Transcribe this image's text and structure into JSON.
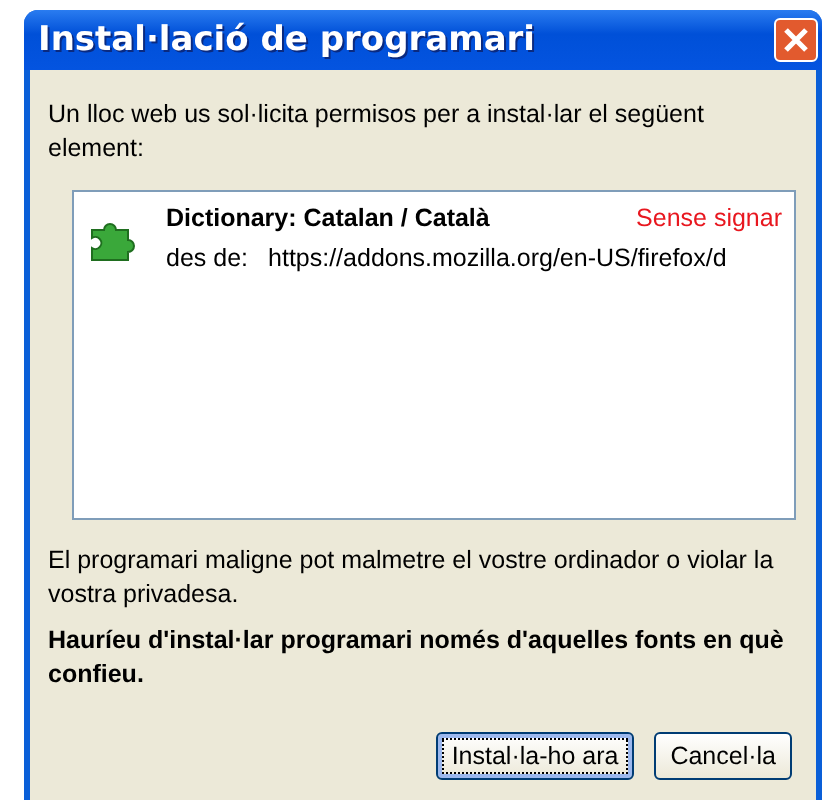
{
  "window": {
    "title": "Instal·lació de programari"
  },
  "intro": "Un lloc web us sol·licita permisos per a instal·lar el següent element:",
  "items": [
    {
      "name": "Dictionary: Catalan / Català",
      "status": "Sense signar",
      "from_label": "des de:",
      "url": "https://addons.mozilla.org/en-US/firefox/d"
    }
  ],
  "warning": "El programari maligne pot malmetre el vostre ordinador o violar la vostra privadesa.",
  "advice": "Hauríeu d'instal·lar programari només d'aquelles fonts en què confieu.",
  "buttons": [
    {
      "label": "Instal·la-ho ara",
      "default": true
    },
    {
      "label": "Cancel·la",
      "default": false
    }
  ]
}
